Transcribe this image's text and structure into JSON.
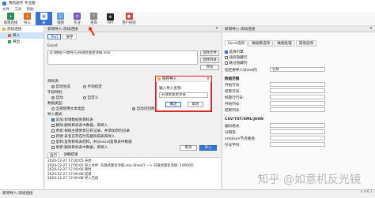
{
  "window": {
    "title": "我的助手 专业版"
  },
  "menu": [
    "文件",
    "工具",
    "帮助"
  ],
  "toolbar": [
    {
      "label": "新建连接",
      "icon": "plug-icon",
      "color": "#2e8b57"
    },
    {
      "label": "导入",
      "icon": "import-icon",
      "color": "#e06c2a"
    },
    {
      "label": "表",
      "icon": "table-icon",
      "color": "#3b73d1",
      "active": true
    },
    {
      "label": "视图",
      "icon": "view-icon",
      "color": "#5a9bd8"
    },
    {
      "label": "作业",
      "icon": "job-icon",
      "color": "#7a57c9"
    },
    {
      "label": "查询",
      "icon": "query-icon",
      "color": "#888888"
    },
    {
      "label": "API",
      "icon": "api-icon",
      "color": "#222222"
    },
    {
      "label": "用户权限",
      "icon": "user-icon",
      "color": "#d44a4a"
    }
  ],
  "sidebar": {
    "items": [
      {
        "label": "测试连接",
        "level": 0
      },
      {
        "label": "导入",
        "level": 1,
        "selected": true
      },
      {
        "label": "导出",
        "level": 1
      }
    ]
  },
  "center": {
    "header_title": "新增导入-测试连接",
    "tabs": [
      "Text",
      "保存"
    ],
    "excel_label": "Excel:",
    "file_path": "D:/教程/一键导入/开放式基金净值.xlsx",
    "btn_select_file": "选择文件",
    "btn_select_dir": "选择目录",
    "btn_preview": "预览",
    "target_table_label": "目标表:",
    "target_auto": "自动生成",
    "target_manual": "手动指定",
    "field_mapping_label": "字段映射:",
    "mapping_auto": "自动",
    "mapping_custom": "自定义",
    "data_type_label": "数据类型:",
    "type_all_text": "全部使用文本类型",
    "type_auto": "自动识别数字及日期类型",
    "import_mode_label": "导入模式:",
    "mode_options": [
      "追加:新增数据到目标表",
      "删除:删除目标表中数据，再导入",
      "更新:根据主键更新已有记录，并添加新的记录"
    ],
    "mode_extra": [
      "新建:表名已存在时先删除旧表再导入",
      "复制:复制目标表结构，并从excel复制表中数据",
      "更新:删除目标表中数据，再导入"
    ],
    "btn_cancel": "取消",
    "btn_import": "导入"
  },
  "log": {
    "tabs": [
      "运行",
      "详细结果"
    ],
    "lines": [
      "2024-12-27 17:00:05  开始",
      "2024-12-27 17:00:05  导入文件: 开放式基金净值.xlsx.Sheet1 —> 开放式基金净值: 10000行",
      "2024-12-27 17:00:06  耗时",
      "2024-12-27 17:00:08  结束",
      "2024-12-27 17:00:08  导入完成"
    ]
  },
  "right": {
    "header_title": "新增导入-测试连接",
    "tabs": [
      "Excel选项",
      "数据库选项",
      "数据处理",
      "其他选项"
    ],
    "check_preview": "选择引擎",
    "check_hidden": "读取隐藏行",
    "check_skip": "跳过隐藏列",
    "sheet_label": "指定要导入Sheet的",
    "sheet_value": "名称",
    "data_range_label": "数据范围",
    "start_row_label": "开始行号:",
    "end_row_label": "结束行号:",
    "header_row_label": "标题行行号:",
    "start_col_label": "开始列号:",
    "end_col_label": "结束列号:",
    "csv_label": "CSV/TXT/XML/JSON",
    "encoding_label": "编码格式:",
    "delimiter_label": "分隔符:",
    "xml_path_label": "xml/json节点路径:",
    "quote_label": "引号字符:",
    "version": "v 4.6.1"
  },
  "dialog": {
    "title": "保存导入",
    "prompt": "输入导入名称:",
    "value": "开放式基金净值",
    "ok": "确定",
    "cancel": "取消"
  },
  "status": {
    "text": "新增导入-测试连接"
  },
  "watermark": "知乎 @如意机反光镜"
}
